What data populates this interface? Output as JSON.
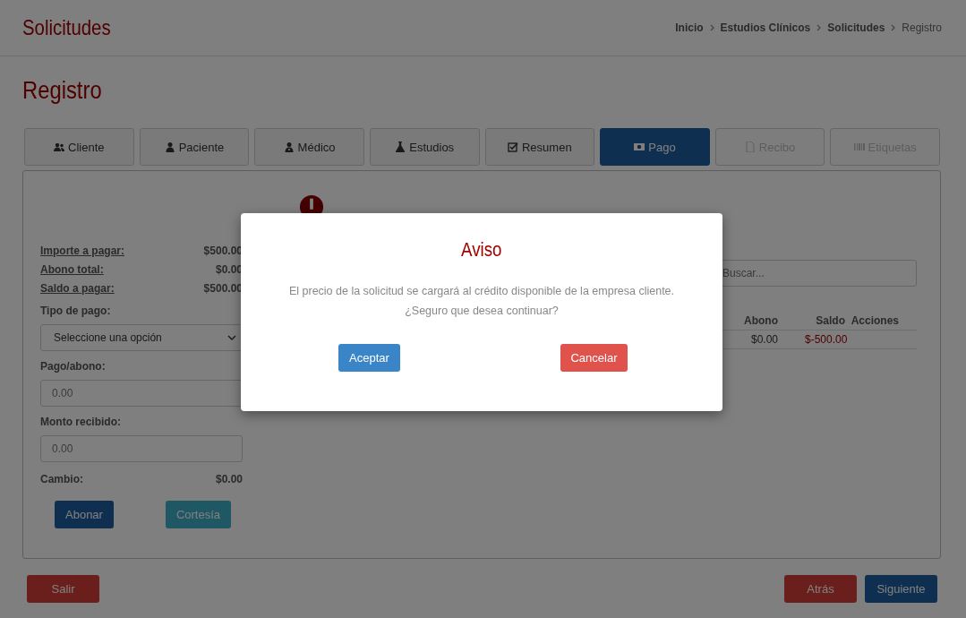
{
  "header": {
    "title": "Solicitudes",
    "breadcrumb": [
      {
        "label": "Inicio",
        "current": false
      },
      {
        "label": "Estudios Clínicos",
        "current": false
      },
      {
        "label": "Solicitudes",
        "current": false
      },
      {
        "label": "Registro",
        "current": true
      }
    ]
  },
  "page_title": "Registro",
  "tabs": [
    {
      "label": "Cliente",
      "kind": "users",
      "selected": false,
      "disabled": false
    },
    {
      "label": "Paciente",
      "kind": "user",
      "selected": false,
      "disabled": false
    },
    {
      "label": "Médico",
      "kind": "doctor",
      "selected": false,
      "disabled": false
    },
    {
      "label": "Estudios",
      "kind": "flask",
      "selected": false,
      "disabled": false
    },
    {
      "label": "Resumen",
      "kind": "check",
      "selected": false,
      "disabled": false
    },
    {
      "label": "Pago",
      "kind": "money",
      "selected": true,
      "disabled": false
    },
    {
      "label": "Recibo",
      "kind": "file",
      "selected": false,
      "disabled": true
    },
    {
      "label": "Etiquetas",
      "kind": "barcode",
      "selected": false,
      "disabled": true
    }
  ],
  "summary": [
    {
      "label": "Importe a pagar:",
      "value": "$500.00"
    },
    {
      "label": "Abono total:",
      "value": "$0.00"
    },
    {
      "label": "Saldo a pagar:",
      "value": "$500.00"
    }
  ],
  "payment_type": {
    "label": "Tipo de pago:",
    "value": "Seleccione una opción"
  },
  "payment": {
    "label": "Pago/abono:",
    "placeholder": "0.00"
  },
  "received": {
    "label": "Monto recibido:",
    "placeholder": "0.00"
  },
  "change": {
    "label": "Cambio:",
    "value": "$0.00"
  },
  "actions": [
    "Abonar",
    "Cortesía"
  ],
  "search": {
    "placeholder": "Buscar..."
  },
  "table": {
    "columns": [
      "Abono",
      "Saldo",
      "Acciones"
    ],
    "rows": [
      [
        "$0.00",
        "$-500.00",
        ""
      ]
    ]
  },
  "footer": {
    "left": "Salir",
    "right": [
      "Atrás",
      "Siguiente"
    ]
  },
  "modal": {
    "title": "Aviso",
    "message": [
      "El precio de la solicitud se cargará al crédito disponible de la empresa cliente.",
      "¿Seguro que desea continuar?"
    ],
    "confirm": "Aceptar",
    "cancel": "Cancelar"
  }
}
